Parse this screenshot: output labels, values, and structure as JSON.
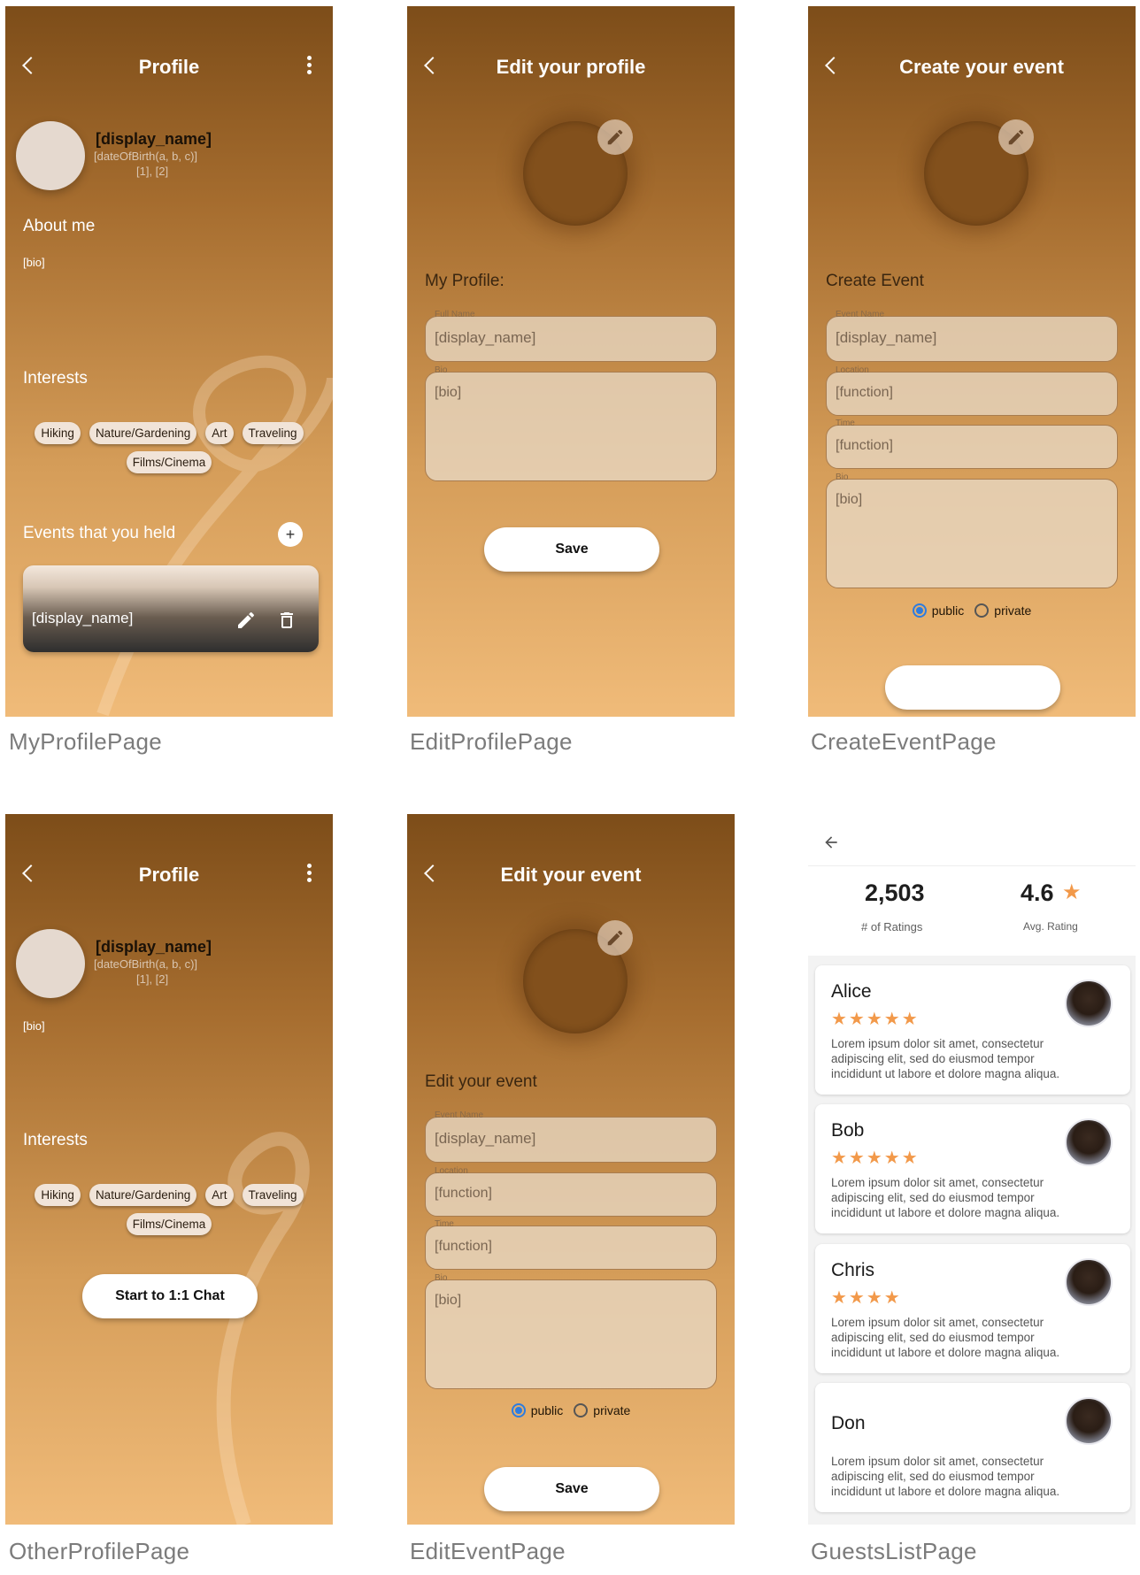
{
  "captions": {
    "my_profile": "MyProfilePage",
    "edit_profile": "EditProfilePage",
    "create_event": "CreateEventPage",
    "other_profile": "OtherProfilePage",
    "edit_event": "EditEventPage",
    "guests_list": "GuestsListPage"
  },
  "my_profile": {
    "title": "Profile",
    "display_name": "[display_name]",
    "dob": "[dateOfBirth(a, b, c)]",
    "refs": "[1], [2]",
    "about_header": "About me",
    "bio": "[bio]",
    "interests_header": "Interests",
    "interests": [
      "Hiking",
      "Nature/Gardening",
      "Art",
      "Traveling",
      "Films/Cinema"
    ],
    "events_header": "Events that you held",
    "add_label": "+",
    "event_card_label": "[display_name]"
  },
  "edit_profile": {
    "title": "Edit your profile",
    "subheader": "My Profile:",
    "full_name_label": "Full Name",
    "full_name_value": "[display_name]",
    "bio_label": "Bio",
    "bio_value": "[bio]",
    "save_label": "Save"
  },
  "create_event": {
    "title": "Create your event",
    "subheader": "Create Event",
    "event_name_label": "Event Name",
    "event_name_value": "[display_name]",
    "location_label": "Location",
    "location_value": "[function]",
    "time_label": "Time",
    "time_value": "[function]",
    "bio_label": "Bio",
    "bio_value": "[bio]",
    "public_label": "public",
    "private_label": "private"
  },
  "other_profile": {
    "title": "Profile",
    "display_name": "[display_name]",
    "dob": "[dateOfBirth(a, b, c)]",
    "refs": "[1], [2]",
    "bio": "[bio]",
    "interests_header": "Interests",
    "interests": [
      "Hiking",
      "Nature/Gardening",
      "Art",
      "Traveling",
      "Films/Cinema"
    ],
    "chat_label": "Start to 1:1 Chat"
  },
  "edit_event": {
    "title": "Edit your event",
    "subheader": "Edit your event",
    "event_name_label": "Event Name",
    "event_name_value": "[display_name]",
    "location_label": "Location",
    "location_value": "[function]",
    "time_label": "Time",
    "time_value": "[function]",
    "bio_label": "Bio",
    "bio_value": "[bio]",
    "public_label": "public",
    "private_label": "private",
    "save_label": "Save"
  },
  "guests": {
    "ratings_count": "2,503",
    "ratings_label": "# of Ratings",
    "avg_rating": "4.6",
    "avg_label": "Avg. Rating",
    "star_color": "#f2994a",
    "reviews": [
      {
        "name": "Alice",
        "stars": "★★★★★",
        "text": "Lorem ipsum dolor sit amet, consectetur adipiscing elit, sed do eiusmod tempor incididunt ut labore et dolore magna aliqua."
      },
      {
        "name": "Bob",
        "stars": "★★★★★",
        "text": "Lorem ipsum dolor sit amet, consectetur adipiscing elit, sed do eiusmod tempor incididunt ut labore et dolore magna aliqua."
      },
      {
        "name": "Chris",
        "stars": "★★★★",
        "text": "Lorem ipsum dolor sit amet, consectetur adipiscing elit, sed do eiusmod tempor incididunt ut labore et dolore magna aliqua."
      },
      {
        "name": "Don",
        "stars": "",
        "text": "Lorem ipsum dolor sit amet, consectetur adipiscing elit, sed do eiusmod tempor incididunt ut labore et dolore magna aliqua."
      }
    ]
  }
}
